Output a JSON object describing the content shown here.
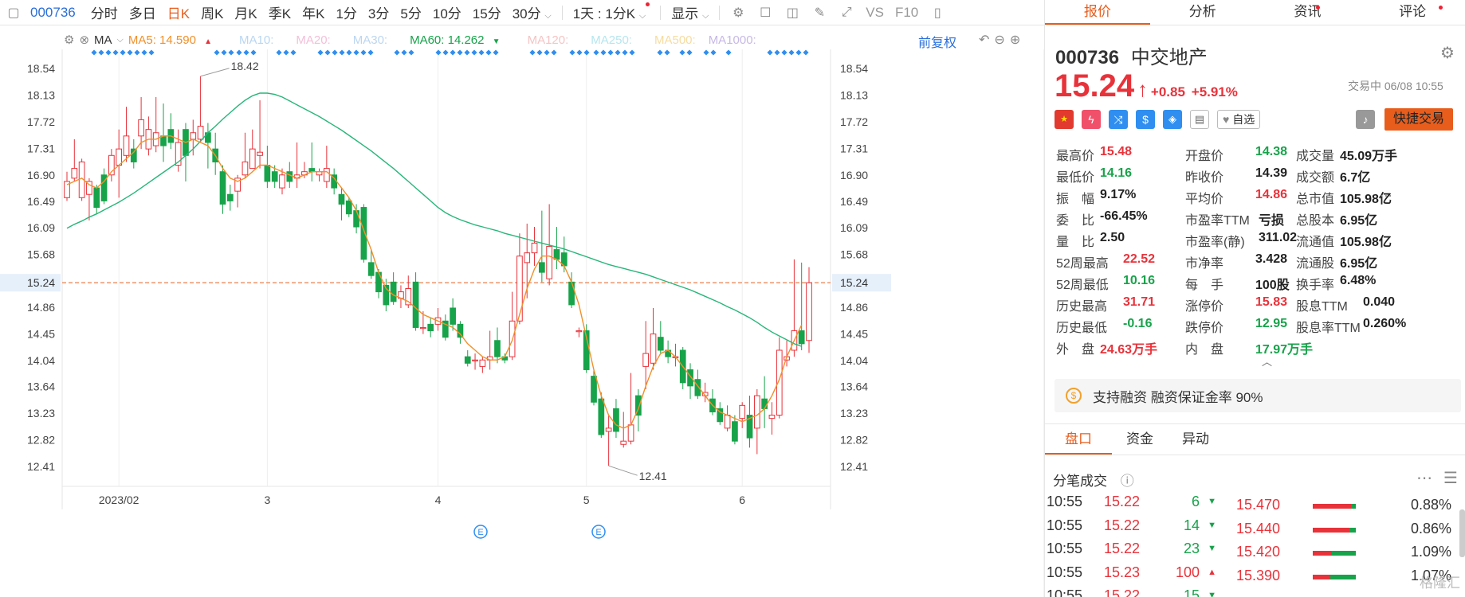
{
  "toolbar": {
    "code": "000736",
    "periods": [
      "分时",
      "多日",
      "日K",
      "周K",
      "月K",
      "季K",
      "年K",
      "1分",
      "3分",
      "5分",
      "10分",
      "15分",
      "30分"
    ],
    "active_period": "日K",
    "range": "1天 : 1分K",
    "display": "显示",
    "vs": "VS",
    "f10": "F10"
  },
  "ma_bar": {
    "type": "MA",
    "ma5": "MA5: 14.590",
    "ma10": "MA10:",
    "ma20": "MA20:",
    "ma30": "MA30:",
    "ma60": "MA60: 14.262",
    "ma120": "MA120:",
    "ma250": "MA250:",
    "ma500": "MA500:",
    "ma1000": "MA1000:",
    "adjust": "前复权"
  },
  "chart_data": {
    "type": "candlestick",
    "y_ticks": [
      "18.54",
      "18.13",
      "17.72",
      "17.31",
      "16.90",
      "16.49",
      "16.09",
      "15.68",
      "15.24",
      "14.86",
      "14.45",
      "14.04",
      "13.64",
      "13.23",
      "12.82",
      "12.41"
    ],
    "x_labels": [
      "2023/02",
      "3",
      "4",
      "5",
      "6"
    ],
    "current_price_label": "15.24",
    "high_annotation": "18.42",
    "low_annotation": "12.41",
    "event_marker": "E",
    "candles": [
      [
        16.55,
        16.8,
        16.5,
        16.95
      ],
      [
        16.85,
        17.0,
        16.8,
        17.45
      ],
      [
        16.55,
        17.1,
        16.5,
        17.15
      ],
      [
        16.6,
        16.8,
        16.2,
        16.85
      ],
      [
        16.7,
        16.4,
        16.3,
        16.75
      ],
      [
        16.9,
        16.5,
        16.45,
        17.0
      ],
      [
        16.9,
        17.2,
        16.8,
        17.3
      ],
      [
        17.05,
        17.3,
        16.55,
        17.6
      ],
      [
        17.2,
        17.5,
        17.1,
        17.95
      ],
      [
        17.3,
        17.1,
        17.0,
        17.45
      ],
      [
        17.5,
        17.75,
        17.3,
        18.1
      ],
      [
        17.3,
        17.6,
        17.2,
        17.8
      ],
      [
        17.35,
        17.55,
        17.25,
        18.1
      ],
      [
        17.5,
        17.35,
        17.1,
        18.0
      ],
      [
        17.6,
        17.4,
        17.3,
        17.85
      ],
      [
        17.05,
        17.4,
        16.95,
        17.6
      ],
      [
        17.6,
        17.2,
        16.8,
        17.7
      ],
      [
        17.45,
        17.55,
        17.2,
        17.75
      ],
      [
        17.45,
        17.65,
        17.4,
        18.42
      ],
      [
        17.55,
        17.4,
        17.0,
        17.7
      ],
      [
        17.3,
        17.1,
        16.9,
        17.55
      ],
      [
        16.95,
        16.45,
        16.3,
        17.05
      ],
      [
        16.6,
        16.5,
        16.35,
        16.75
      ],
      [
        16.65,
        16.85,
        16.4,
        16.9
      ],
      [
        16.9,
        17.1,
        16.85,
        17.55
      ],
      [
        17.0,
        17.3,
        17.0,
        17.6
      ],
      [
        17.2,
        17.25,
        17.0,
        18.05
      ],
      [
        17.05,
        16.8,
        16.7,
        17.35
      ],
      [
        16.95,
        16.8,
        16.7,
        17.05
      ],
      [
        16.7,
        16.9,
        16.6,
        17.0
      ],
      [
        16.95,
        16.8,
        16.7,
        17.1
      ],
      [
        16.85,
        16.9,
        16.7,
        17.4
      ],
      [
        16.9,
        16.95,
        16.85,
        17.1
      ],
      [
        17.0,
        16.95,
        16.8,
        17.4
      ],
      [
        16.9,
        16.95,
        16.8,
        17.0
      ],
      [
        16.8,
        17.0,
        16.7,
        17.35
      ],
      [
        16.9,
        16.7,
        16.6,
        17.0
      ],
      [
        16.6,
        16.45,
        16.2,
        16.7
      ],
      [
        16.5,
        16.3,
        16.25,
        16.55
      ],
      [
        16.35,
        16.1,
        16.0,
        16.45
      ],
      [
        16.4,
        15.6,
        15.55,
        16.45
      ],
      [
        15.55,
        15.35,
        15.3,
        15.75
      ],
      [
        15.4,
        15.1,
        15.0,
        15.45
      ],
      [
        15.2,
        14.9,
        14.8,
        15.3
      ],
      [
        15.25,
        14.95,
        14.9,
        15.4
      ],
      [
        15.0,
        15.1,
        14.85,
        15.2
      ],
      [
        14.9,
        15.15,
        14.85,
        15.35
      ],
      [
        15.25,
        14.55,
        14.5,
        15.4
      ],
      [
        14.55,
        14.55,
        14.45,
        14.8
      ],
      [
        14.6,
        14.5,
        14.4,
        14.7
      ],
      [
        14.6,
        14.7,
        14.5,
        14.85
      ],
      [
        14.65,
        14.4,
        14.35,
        14.75
      ],
      [
        14.85,
        14.6,
        14.5,
        15.0
      ],
      [
        14.6,
        14.4,
        14.3,
        14.65
      ],
      [
        14.1,
        14.0,
        13.95,
        14.2
      ],
      [
        14.05,
        14.05,
        13.9,
        14.15
      ],
      [
        13.95,
        14.05,
        13.85,
        14.1
      ],
      [
        14.05,
        14.1,
        13.9,
        14.5
      ],
      [
        14.35,
        14.1,
        14.0,
        14.55
      ],
      [
        14.1,
        14.05,
        14.0,
        14.15
      ],
      [
        14.1,
        14.65,
        14.05,
        15.1
      ],
      [
        14.65,
        15.65,
        14.6,
        16.0
      ],
      [
        15.55,
        15.7,
        15.0,
        16.15
      ],
      [
        15.7,
        15.85,
        15.5,
        16.1
      ],
      [
        15.55,
        15.4,
        15.25,
        16.35
      ],
      [
        15.3,
        15.8,
        15.2,
        16.45
      ],
      [
        15.75,
        15.6,
        15.45,
        16.1
      ],
      [
        15.7,
        15.5,
        15.4,
        15.95
      ],
      [
        15.25,
        14.9,
        14.85,
        15.4
      ],
      [
        14.5,
        14.5,
        14.4,
        14.55
      ],
      [
        14.5,
        13.9,
        13.85,
        14.6
      ],
      [
        13.8,
        13.4,
        13.35,
        13.9
      ],
      [
        13.45,
        12.9,
        12.85,
        13.55
      ],
      [
        12.95,
        13.0,
        12.42,
        13.2
      ],
      [
        13.3,
        12.95,
        12.85,
        13.45
      ],
      [
        12.75,
        12.8,
        12.7,
        13.25
      ],
      [
        12.8,
        13.05,
        12.75,
        13.85
      ],
      [
        13.5,
        13.2,
        12.95,
        13.6
      ],
      [
        13.95,
        14.15,
        13.6,
        14.65
      ],
      [
        14.0,
        14.45,
        13.9,
        14.85
      ],
      [
        14.4,
        14.2,
        14.15,
        14.65
      ],
      [
        14.2,
        14.1,
        14.0,
        14.35
      ],
      [
        14.1,
        14.1,
        13.95,
        14.3
      ],
      [
        14.2,
        13.7,
        13.6,
        14.25
      ],
      [
        13.9,
        13.65,
        13.45,
        14.0
      ],
      [
        13.75,
        13.5,
        13.45,
        13.9
      ],
      [
        13.5,
        13.55,
        13.4,
        13.7
      ],
      [
        13.45,
        13.25,
        13.2,
        13.6
      ],
      [
        13.3,
        13.1,
        13.05,
        13.4
      ],
      [
        13.0,
        13.2,
        12.95,
        13.35
      ],
      [
        13.1,
        12.8,
        12.75,
        13.2
      ],
      [
        13.15,
        13.35,
        13.0,
        13.4
      ],
      [
        13.2,
        12.85,
        12.7,
        13.5
      ],
      [
        13.0,
        13.5,
        12.6,
        13.6
      ],
      [
        13.45,
        13.3,
        13.0,
        13.8
      ],
      [
        13.15,
        13.2,
        12.9,
        13.4
      ],
      [
        13.2,
        14.2,
        13.15,
        14.4
      ],
      [
        14.05,
        14.1,
        13.95,
        14.35
      ],
      [
        14.2,
        14.5,
        14.1,
        15.6
      ],
      [
        14.5,
        14.3,
        14.2,
        15.55
      ],
      [
        14.35,
        15.24,
        14.16,
        15.48
      ]
    ],
    "ma5": [
      16.75,
      16.8,
      16.85,
      16.75,
      16.7,
      16.8,
      16.95,
      17.05,
      17.15,
      17.25,
      17.4,
      17.45,
      17.45,
      17.5,
      17.5,
      17.45,
      17.4,
      17.45,
      17.4,
      17.35,
      17.2,
      17.0,
      16.85,
      16.8,
      16.85,
      16.95,
      17.05,
      17.05,
      17.0,
      16.95,
      16.9,
      16.85,
      16.9,
      16.95,
      16.95,
      16.95,
      16.85,
      16.7,
      16.55,
      16.35,
      16.05,
      15.75,
      15.4,
      15.15,
      15.05,
      15.0,
      14.95,
      14.85,
      14.75,
      14.7,
      14.65,
      14.6,
      14.55,
      14.45,
      14.3,
      14.2,
      14.1,
      14.05,
      14.05,
      14.1,
      14.35,
      14.75,
      15.15,
      15.45,
      15.65,
      15.65,
      15.6,
      15.5,
      15.25,
      14.9,
      14.4,
      13.9,
      13.5,
      13.2,
      13.05,
      13.0,
      13.05,
      13.3,
      13.65,
      13.95,
      14.15,
      14.2,
      14.1,
      13.95,
      13.8,
      13.65,
      13.5,
      13.35,
      13.25,
      13.2,
      13.15,
      13.1,
      13.15,
      13.2,
      13.3,
      13.5,
      13.75,
      14.1,
      14.35,
      14.59
    ],
    "ma60": [
      16.08,
      16.14,
      16.19,
      16.25,
      16.3,
      16.36,
      16.42,
      16.48,
      16.55,
      16.62,
      16.7,
      16.78,
      16.86,
      16.94,
      17.02,
      17.1,
      17.2,
      17.3,
      17.42,
      17.55,
      17.65,
      17.76,
      17.86,
      17.96,
      18.05,
      18.12,
      18.16,
      18.16,
      18.14,
      18.1,
      18.04,
      17.98,
      17.92,
      17.86,
      17.8,
      17.73,
      17.66,
      17.59,
      17.51,
      17.43,
      17.35,
      17.27,
      17.18,
      17.09,
      17.0,
      16.9,
      16.8,
      16.7,
      16.6,
      16.5,
      16.4,
      16.32,
      16.26,
      16.21,
      16.17,
      16.13,
      16.1,
      16.07,
      16.04,
      16.0,
      15.97,
      15.94,
      15.91,
      15.88,
      15.85,
      15.82,
      15.79,
      15.76,
      15.72,
      15.68,
      15.64,
      15.6,
      15.56,
      15.52,
      15.49,
      15.46,
      15.43,
      15.4,
      15.37,
      15.33,
      15.29,
      15.25,
      15.21,
      15.17,
      15.13,
      15.08,
      15.03,
      14.98,
      14.93,
      14.87,
      14.82,
      14.76,
      14.7,
      14.63,
      14.55,
      14.48,
      14.42,
      14.36,
      14.3,
      14.26
    ]
  },
  "quote": {
    "code": "000736",
    "name": "中交地产",
    "price": "15.24",
    "change": "+0.85",
    "change_pct": "+5.91%",
    "status": "交易中 06/08 10:55",
    "watch": "自选",
    "fast_trade": "快捷交易"
  },
  "tabs": [
    "报价",
    "分析",
    "资讯",
    "评论"
  ],
  "stats": [
    [
      [
        "最高价",
        "15.48",
        "red"
      ],
      [
        "开盘价",
        "14.38",
        "green"
      ],
      [
        "成交量",
        "45.09万手",
        ""
      ]
    ],
    [
      [
        "最低价",
        "14.16",
        "green"
      ],
      [
        "昨收价",
        "14.39",
        ""
      ],
      [
        "成交额",
        "6.7亿",
        ""
      ]
    ],
    [
      [
        "振　幅",
        "9.17%",
        ""
      ],
      [
        "平均价",
        "14.86",
        "red"
      ],
      [
        "总市值",
        "105.98亿",
        ""
      ]
    ],
    [
      [
        "委　比",
        "-66.45%",
        ""
      ],
      [
        "市盈率TTM",
        "亏损",
        ""
      ],
      [
        "总股本",
        "6.95亿",
        ""
      ]
    ],
    [
      [
        "量　比",
        "2.50",
        ""
      ],
      [
        "市盈率(静)",
        "311.02",
        ""
      ],
      [
        "流通值",
        "105.98亿",
        ""
      ]
    ],
    [
      [
        "52周最高",
        "22.52",
        "red"
      ],
      [
        "市净率",
        "3.428",
        ""
      ],
      [
        "流通股",
        "6.95亿",
        ""
      ]
    ],
    [
      [
        "52周最低",
        "10.16",
        "green"
      ],
      [
        "每　手",
        "100股",
        ""
      ],
      [
        "换手率",
        "6.48%",
        ""
      ]
    ],
    [
      [
        "历史最高",
        "31.71",
        "red"
      ],
      [
        "涨停价",
        "15.83",
        "red"
      ],
      [
        "股息TTM",
        "0.040",
        ""
      ]
    ],
    [
      [
        "历史最低",
        "-0.16",
        "green"
      ],
      [
        "跌停价",
        "12.95",
        "green"
      ],
      [
        "股息率TTM",
        "0.260%",
        ""
      ]
    ],
    [
      [
        "外　盘",
        "24.63万手",
        "red"
      ],
      [
        "内　盘",
        "17.97万手",
        "green"
      ],
      [
        "",
        "",
        ""
      ]
    ]
  ],
  "margin_text": "支持融资 融资保证金率 90%",
  "subtabs": [
    "盘口",
    "资金",
    "异动"
  ],
  "trades_title": "分笔成交",
  "trades": [
    {
      "time": "10:55",
      "price": "15.22",
      "vol": "6",
      "dir": "down"
    },
    {
      "time": "10:55",
      "price": "15.22",
      "vol": "14",
      "dir": "down"
    },
    {
      "time": "10:55",
      "price": "15.22",
      "vol": "23",
      "dir": "down"
    },
    {
      "time": "10:55",
      "price": "15.23",
      "vol": "100",
      "dir": "up"
    },
    {
      "time": "10:55",
      "price": "15.22",
      "vol": "15",
      "dir": "down"
    }
  ],
  "levels": [
    {
      "price": "15.470",
      "pct": "0.88%",
      "red": 0.88
    },
    {
      "price": "15.440",
      "pct": "0.86%",
      "red": 0.86
    },
    {
      "price": "15.420",
      "pct": "1.09%",
      "red": 0.45
    },
    {
      "price": "15.390",
      "pct": "1.07%",
      "red": 0.4
    }
  ],
  "watermark": "格隆汇",
  "colors": {
    "up": "#e8323a",
    "down": "#17a34a",
    "accent": "#e85d1c",
    "ma5": "#f0902a",
    "ma60": "#27b67a",
    "link": "#2a6fdb"
  }
}
